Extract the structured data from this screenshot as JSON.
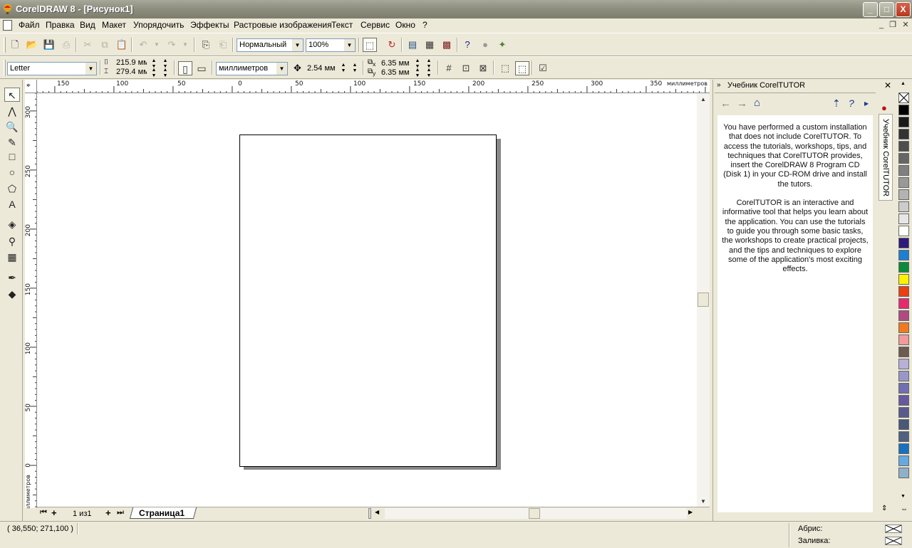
{
  "window": {
    "title": "CorelDRAW 8 - [Рисунок1]",
    "controls": {
      "minimize": "_",
      "maximize": "□",
      "close": "X"
    }
  },
  "menu": {
    "items": [
      "Файл",
      "Правка",
      "Вид",
      "Макет",
      "Упорядочить",
      "Эффекты",
      "Растровые изображения",
      "Текст",
      "Сервис",
      "Окно",
      "?"
    ]
  },
  "standard_toolbar": {
    "view_quality": "Нормальный",
    "zoom": "100%"
  },
  "property_bar": {
    "paper_size": "Letter",
    "width": "215.9 мм",
    "height": "279.4 мм",
    "units": "миллиметров",
    "nudge": "2.54 мм",
    "dup_x": "6.35 мм",
    "dup_y": "6.35 мм",
    "sub_x": "x",
    "sub_y": "y"
  },
  "rulers": {
    "unit_label": "миллиметров",
    "h_ticks": [
      "150",
      "100",
      "50",
      "0",
      "50",
      "100",
      "150",
      "200",
      "250",
      "300",
      "350"
    ],
    "v_ticks": [
      "300",
      "250",
      "200",
      "150",
      "100",
      "50",
      "0"
    ]
  },
  "page_nav": {
    "counter": "1 из1",
    "tab": "Страница1"
  },
  "docker": {
    "title": "Учебник CorelTUTOR",
    "tab_label": "Учебник CorelTUTOR",
    "paragraph1": "You have performed a custom installation that does not include CorelTUTOR. To access the tutorials, workshops, tips, and techniques that CorelTUTOR provides, insert the CorelDRAW 8 Program CD (Disk 1) in your CD-ROM drive and install the tutors.",
    "paragraph2": "CorelTUTOR is an interactive and informative tool that helps you learn about the application. You can use the tutorials to guide you through some basic tasks, the workshops to create practical projects, and the tips and techniques to explore some of the application's most exciting effects."
  },
  "palette": {
    "colors": [
      "#000000",
      "#1a1a1a",
      "#333333",
      "#4d4d4d",
      "#666666",
      "#808080",
      "#999999",
      "#b3b3b3",
      "#cccccc",
      "#e6e6e6",
      "#ffffff",
      "#2e1a7a",
      "#1e7fd0",
      "#0a8a3a",
      "#fff200",
      "#e84010",
      "#e8286e",
      "#b04a80",
      "#f07a20",
      "#f29a9a",
      "#6e5a50",
      "#b8b0d8",
      "#9898c8",
      "#7070b0",
      "#6858a0",
      "#5a5a90",
      "#485878",
      "#506080",
      "#1870c0",
      "#68a8e0",
      "#90b0c8"
    ]
  },
  "status": {
    "coords": "( 36,550; 271,100 )",
    "outline_label": "Абрис:",
    "fill_label": "Заливка:"
  }
}
